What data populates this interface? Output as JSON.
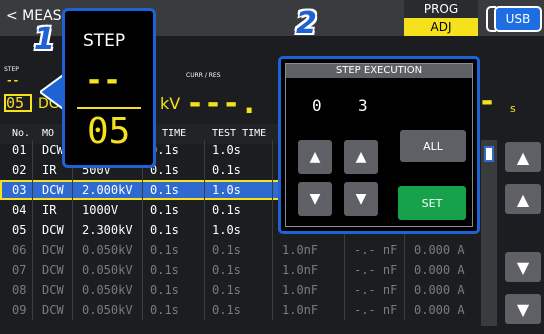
{
  "topbar": {
    "back_label": "< MEAS",
    "prog_label": "PROG",
    "adj_label": "ADJ",
    "usb_label": "USB"
  },
  "readout": {
    "step_label": "STEP",
    "step_dash": "--",
    "step_value": "05",
    "dcw_fragment": "DC",
    "kv_fragment": "kV",
    "curr_label": "CURR / RES",
    "curr_dashes": "---.",
    "timer_dashes": "-",
    "timer_unit": "s"
  },
  "table": {
    "headers": [
      "No.",
      "MO",
      "",
      "E TIME",
      "TEST TIME",
      "",
      "",
      ""
    ],
    "rows": [
      {
        "cells": [
          "01",
          "DCW",
          "",
          "0.1s",
          "1.0s",
          "",
          "",
          ""
        ],
        "dim": false,
        "sel": false
      },
      {
        "cells": [
          "02",
          "IR",
          "500V",
          "0.1s",
          "0.1s",
          "",
          "",
          ""
        ],
        "dim": false,
        "sel": false
      },
      {
        "cells": [
          "03",
          "DCW",
          "2.000kV",
          "0.1s",
          "1.0s",
          "",
          "",
          ""
        ],
        "dim": false,
        "sel": true
      },
      {
        "cells": [
          "04",
          "IR",
          "1000V",
          "0.1s",
          "0.1s",
          "",
          "",
          ""
        ],
        "dim": false,
        "sel": false
      },
      {
        "cells": [
          "05",
          "DCW",
          "2.300kV",
          "0.1s",
          "1.0s",
          "1.0nF",
          "-.- nF",
          "0.000 A"
        ],
        "dim": false,
        "sel": false
      },
      {
        "cells": [
          "06",
          "DCW",
          "0.050kV",
          "0.1s",
          "0.1s",
          "1.0nF",
          "-.- nF",
          "0.000 A"
        ],
        "dim": true,
        "sel": false
      },
      {
        "cells": [
          "07",
          "DCW",
          "0.050kV",
          "0.1s",
          "0.1s",
          "1.0nF",
          "-.- nF",
          "0.000 A"
        ],
        "dim": true,
        "sel": false
      },
      {
        "cells": [
          "08",
          "DCW",
          "0.050kV",
          "0.1s",
          "0.1s",
          "1.0nF",
          "-.- nF",
          "0.000 A"
        ],
        "dim": true,
        "sel": false
      },
      {
        "cells": [
          "09",
          "DCW",
          "0.050kV",
          "0.1s",
          "0.1s",
          "1.0nF",
          "-.- nF",
          "0.000 A"
        ],
        "dim": true,
        "sel": false
      }
    ]
  },
  "step_zoom": {
    "label": "STEP",
    "dash": "--",
    "value": "05"
  },
  "callouts": {
    "one": "1",
    "two": "2"
  },
  "step_execution": {
    "title": "STEP EXECUTION",
    "digit1": "0",
    "digit2": "3",
    "all_label": "ALL",
    "set_label": "SET"
  },
  "icons": {
    "up": "▲",
    "down": "▼"
  },
  "colors": {
    "accent": "#1e62d6",
    "highlight": "#f5e21d",
    "set": "#16a24a"
  }
}
